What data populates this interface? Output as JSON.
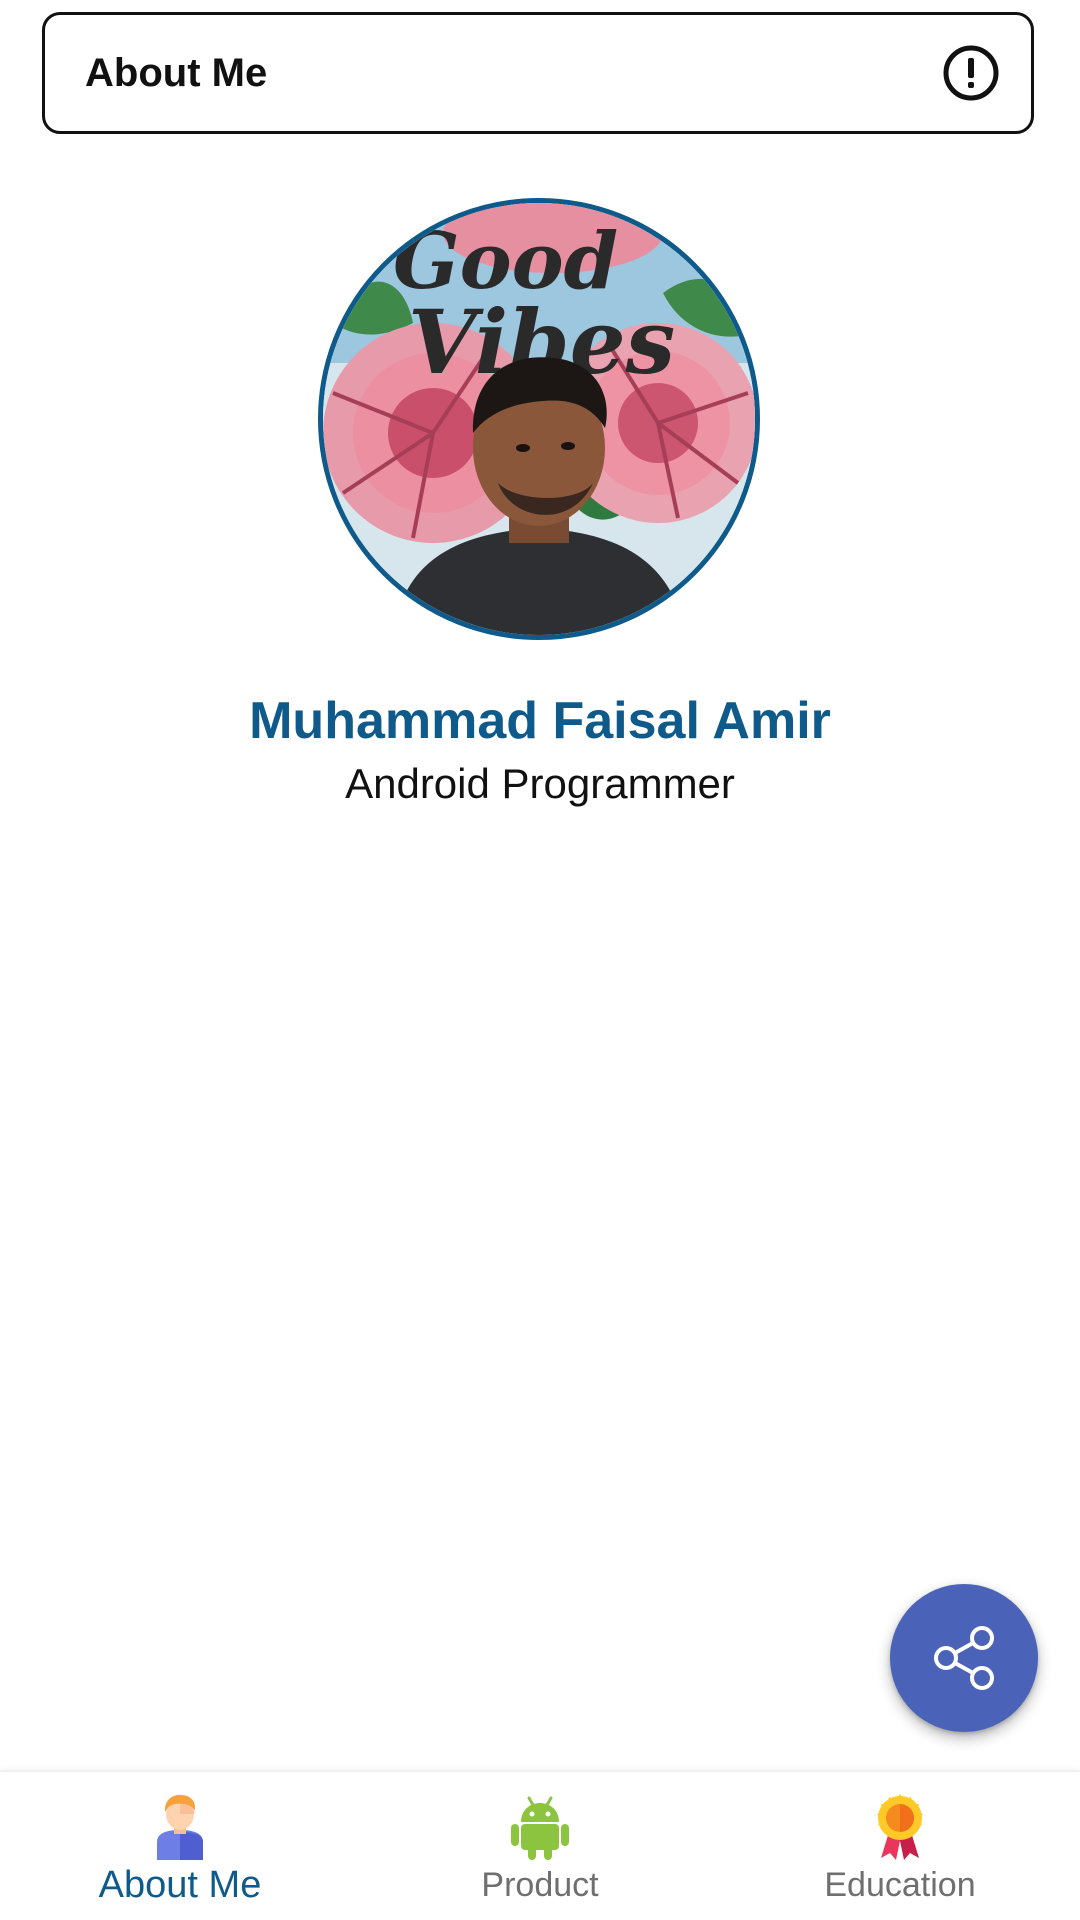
{
  "app_bar": {
    "title": "About Me",
    "info_icon": "info-icon"
  },
  "profile": {
    "name": "Muhammad Faisal Amir",
    "role": "Android Programmer",
    "name_color": "#0e5a8a"
  },
  "fab": {
    "icon": "share-icon",
    "color": "#4a63b8"
  },
  "bottom_nav": {
    "active_color": "#0e5a8a",
    "inactive_color": "#6f6f6f",
    "items": [
      {
        "label": "About Me",
        "icon": "person-icon",
        "active": true
      },
      {
        "label": "Product",
        "icon": "android-icon",
        "active": false
      },
      {
        "label": "Education",
        "icon": "medal-icon",
        "active": false
      }
    ]
  }
}
